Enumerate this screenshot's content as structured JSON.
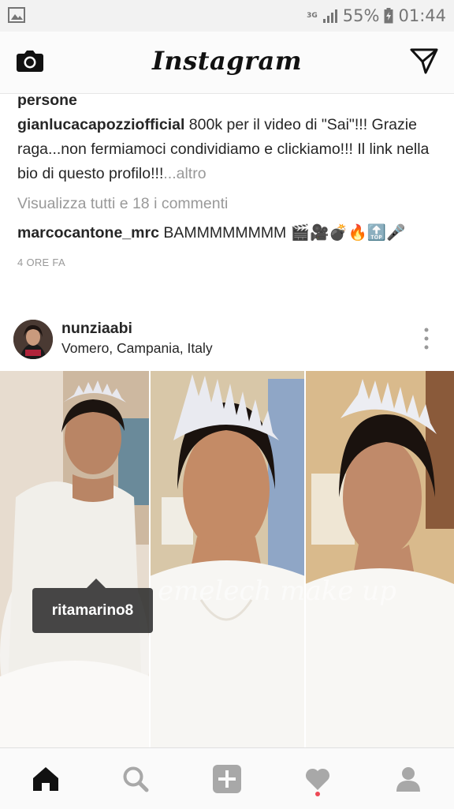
{
  "status_bar": {
    "network": "3G",
    "battery": "55%",
    "time": "01:44"
  },
  "app": {
    "title": "Instagram"
  },
  "feed": {
    "caption_tail": "persone",
    "comments": [
      {
        "user": "gianlucacapozziofficial",
        "text": " 800k per il video di \"Sai\"!!! Grazie raga...non fermiamoci condividiamo e clickiamo!!! Il link nella bio di questo profilo!!!",
        "more": "...altro"
      }
    ],
    "view_all": "Visualizza tutti e 18 i commenti",
    "last_comment": {
      "user": "marcocantone_mrc",
      "text": " BAMMMMMMMM 🎬🎥💣🔥🔝🎤"
    },
    "time_ago": "4 ORE FA"
  },
  "post": {
    "username": "nunziaabi",
    "location": "Vomero, Campania, Italy",
    "photo_watermark": "emelech make up",
    "tag_user": "ritamarino8"
  },
  "tabs": [
    "home-icon",
    "search-icon",
    "add-icon",
    "heart-icon",
    "profile-icon"
  ],
  "colors": {
    "accent_notification": "#ed4956",
    "muted_text": "#999999"
  }
}
